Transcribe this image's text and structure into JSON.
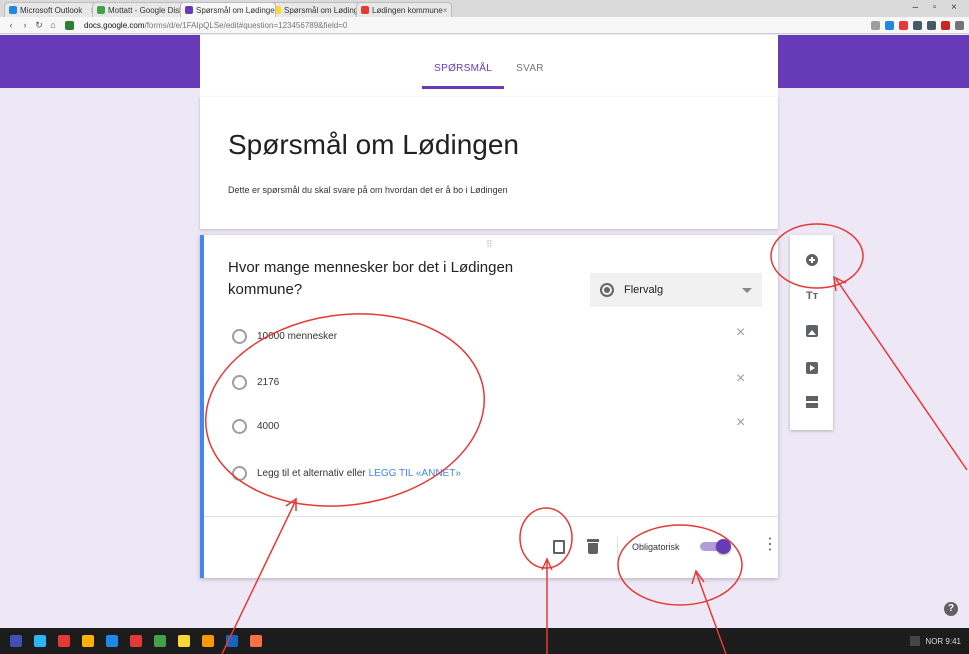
{
  "browser": {
    "tabs": [
      {
        "label": "Microsoft Outlook",
        "color": "#1e88e5",
        "active": false
      },
      {
        "label": "Mottatt - Google Disk",
        "color": "#43a047",
        "active": false
      },
      {
        "label": "Spørsmål om Lødingen",
        "color": "#673ab7",
        "active": true
      },
      {
        "label": "Spørsmål om Lødingen - Google",
        "color": "#fdd835",
        "active": false
      },
      {
        "label": "Lødingen kommune",
        "color": "#e53935",
        "active": false
      }
    ],
    "window_controls": "– ▫ ×",
    "nav": {
      "back": "‹",
      "forward": "›",
      "reload": "↻",
      "home": "⌂"
    },
    "url_host": "docs.google.com",
    "url_path": "/forms/d/e/1FAIpQLSe/edit#question=123456789&field=0"
  },
  "form_tabs": {
    "questions": "SPØRSMÅL",
    "answers": "SVAR"
  },
  "form": {
    "title": "Spørsmål om Lødingen",
    "description": "Dette er spørsmål du skal svare på om hvordan det er å bo i Lødingen"
  },
  "question": {
    "drag_handle": "⠿",
    "text": "Hvor mange mennesker bor det i Lødingen kommune?",
    "type": "Flervalg",
    "options": [
      "10000 mennesker",
      "2176",
      "4000"
    ],
    "option_remove": "×",
    "add_option": "Legg til et alternativ",
    "add_or": "eller",
    "add_other": "LEGG TIL «ANNET»",
    "required_label": "Obligatorisk",
    "required": true,
    "more": "⋮"
  },
  "sidebar": {
    "title_tool": "Tт"
  },
  "help": "?",
  "taskbar": {
    "icons": [
      "#3f51b5",
      "#29b6f6",
      "#e53935",
      "#ffb300",
      "#1e88e5",
      "#e53935",
      "#43a047",
      "#fdd835",
      "#ff9800",
      "#1565c0",
      "#ff7043"
    ],
    "clock": "NOR 9:41"
  },
  "colors": {
    "accent": "#673ab7",
    "question_bar": "#4285f4",
    "annotation": "#e53935"
  }
}
